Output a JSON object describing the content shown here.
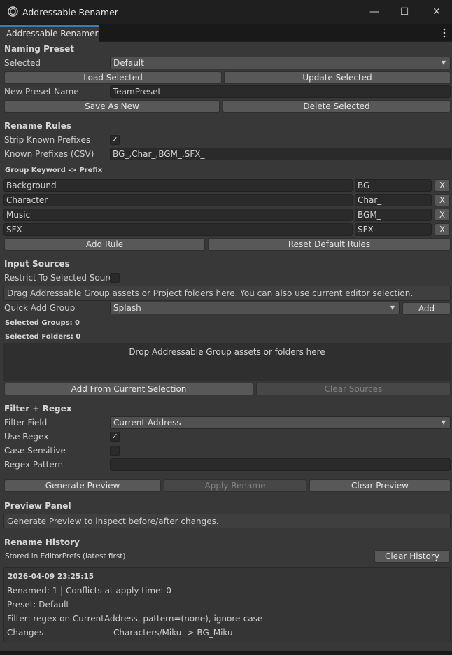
{
  "window": {
    "title": "Addressable Renamer",
    "tab_label": "Addressable Renamer",
    "tab_menu_icon": "kebab-menu-icon",
    "app_icon": "unity-logo-icon",
    "minimize_glyph": "—",
    "maximize_glyph": "☐",
    "close_glyph": "✕"
  },
  "naming_preset": {
    "header": "Naming Preset",
    "selected_label": "Selected",
    "selected_value": "Default",
    "load_selected": "Load Selected",
    "update_selected": "Update Selected",
    "new_preset_label": "New Preset Name",
    "new_preset_value": "TeamPreset",
    "save_as_new": "Save As New",
    "delete_selected": "Delete Selected"
  },
  "rename_rules": {
    "header": "Rename Rules",
    "strip_label": "Strip Known Prefixes",
    "strip_checked": true,
    "known_prefixes_label": "Known Prefixes (CSV)",
    "known_prefixes_value": "BG_,Char_,BGM_,SFX_",
    "group_keyword_header": "Group Keyword -> Prefix",
    "rules": [
      {
        "keyword": "Background",
        "prefix": "BG_",
        "remove": "X"
      },
      {
        "keyword": "Character",
        "prefix": "Char_",
        "remove": "X"
      },
      {
        "keyword": "Music",
        "prefix": "BGM_",
        "remove": "X"
      },
      {
        "keyword": "SFX",
        "prefix": "SFX_",
        "remove": "X"
      }
    ],
    "add_rule": "Add Rule",
    "reset_default": "Reset Default Rules"
  },
  "input_sources": {
    "header": "Input Sources",
    "restrict_label": "Restrict To Selected Sourc",
    "restrict_checked": false,
    "help": "Drag Addressable Group assets or Project folders here. You can also use current editor selection.",
    "quick_add_label": "Quick Add Group",
    "quick_add_value": "Splash",
    "add_button": "Add",
    "selected_groups": "Selected Groups: 0",
    "selected_folders": "Selected Folders: 0",
    "drop_zone_text": "Drop Addressable Group assets or folders here",
    "add_from_selection": "Add From Current Selection",
    "clear_sources": "Clear Sources"
  },
  "filter_regex": {
    "header": "Filter + Regex",
    "filter_field_label": "Filter Field",
    "filter_field_value": "Current Address",
    "use_regex_label": "Use Regex",
    "use_regex_checked": true,
    "case_sensitive_label": "Case Sensitive",
    "case_sensitive_checked": false,
    "regex_pattern_label": "Regex Pattern",
    "regex_pattern_value": ""
  },
  "actions": {
    "generate_preview": "Generate Preview",
    "apply_rename": "Apply Rename",
    "clear_preview": "Clear Preview"
  },
  "preview_panel": {
    "header": "Preview Panel",
    "help": "Generate Preview to inspect before/after changes."
  },
  "rename_history": {
    "header": "Rename History",
    "stored_note": "Stored in EditorPrefs (latest first)",
    "clear_history": "Clear History",
    "entry": {
      "timestamp": "2026-04-09 23:25:15",
      "renamed": "Renamed: 1 | Conflicts at apply time: 0",
      "preset": "Preset: Default",
      "filter": "Filter: regex on CurrentAddress, pattern=(none), ignore-case",
      "changes_label": "Changes",
      "changes_value": "Characters/Miku -> BG_Miku"
    }
  },
  "colors": {
    "panel_bg": "#383838",
    "field_bg": "#2a2a2a",
    "button_bg": "#585858",
    "tab_accent": "#3a79bb",
    "titlebar_bg": "#1f1f1f"
  }
}
